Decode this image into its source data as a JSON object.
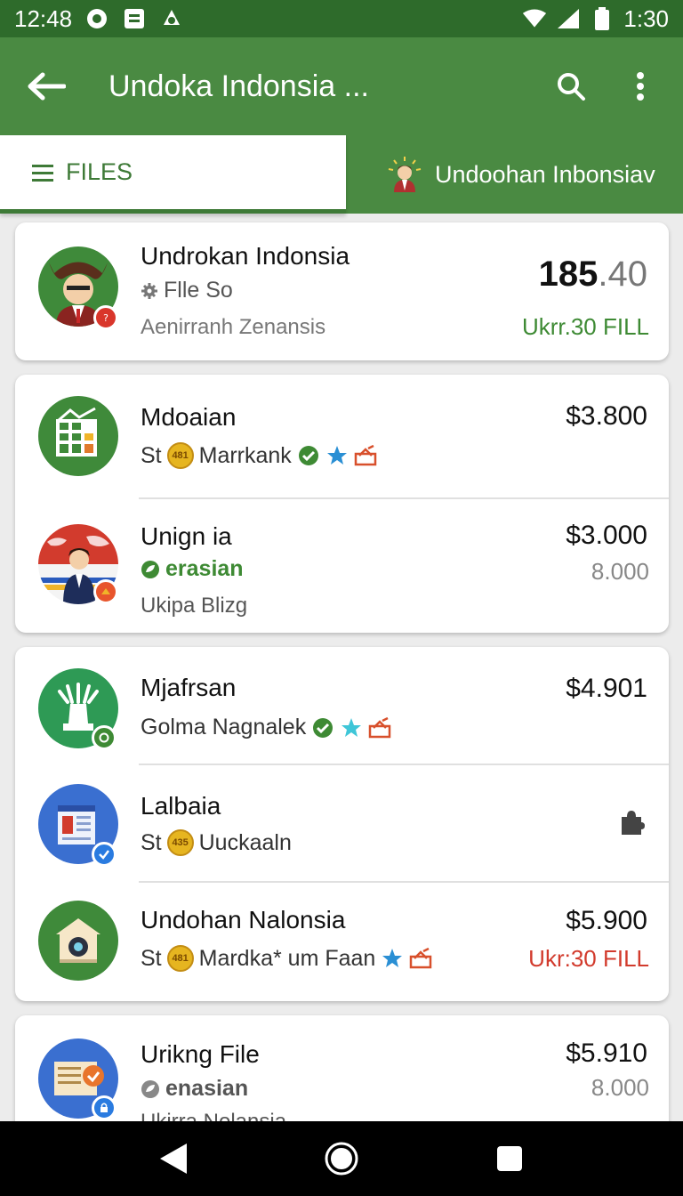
{
  "status_bar": {
    "time": "12:48",
    "clock_right": "1:30"
  },
  "app_bar": {
    "title": "Undoka Indonsia ..."
  },
  "tabs": [
    {
      "label": "FILES"
    },
    {
      "label": "Undoohan Inbonsiav"
    }
  ],
  "cards": [
    {
      "rows": [
        {
          "name": "Undrokan Indonsia",
          "sub": "Flle So",
          "meta": "Aenirranh Zenansis",
          "price_main": "185",
          "price_dec": ".40",
          "price_sub": "Ukrr.30 FILL",
          "price_sub_color": "#3e8a34"
        }
      ]
    },
    {
      "rows": [
        {
          "name": "Mdoaian",
          "sub": "Marrkank",
          "coin_prefix": "St",
          "coin_text": "481",
          "price": "$3.800"
        },
        {
          "name": "Unign ia",
          "sub": "erasian",
          "meta": "Ukipa Blizg",
          "price": "$3.000",
          "price_sub": "8.000"
        }
      ]
    },
    {
      "rows": [
        {
          "name": "Mjafrsan",
          "sub": "Golma Nagnalek",
          "price": "$4.901"
        },
        {
          "name": "Lalbaia",
          "sub": "Uuckaaln",
          "coin_prefix": "St",
          "coin_text": "435"
        },
        {
          "name": "Undohan Nalonsia",
          "sub": "Mardka* um Faan",
          "coin_prefix": "St",
          "coin_text": "481",
          "price": "$5.900",
          "price_sub": "Ukr:30 FILL"
        }
      ]
    },
    {
      "rows": [
        {
          "name": "Urikng File",
          "sub": "enasian",
          "price": "$5.910",
          "price_sub": "8.000",
          "meta": "Ukirra Nolansia"
        }
      ]
    }
  ],
  "colors": {
    "primary": "#4a8a42",
    "status": "#2e6b2b",
    "accent_green": "#3e8a34",
    "accent_red": "#d23b2d"
  }
}
